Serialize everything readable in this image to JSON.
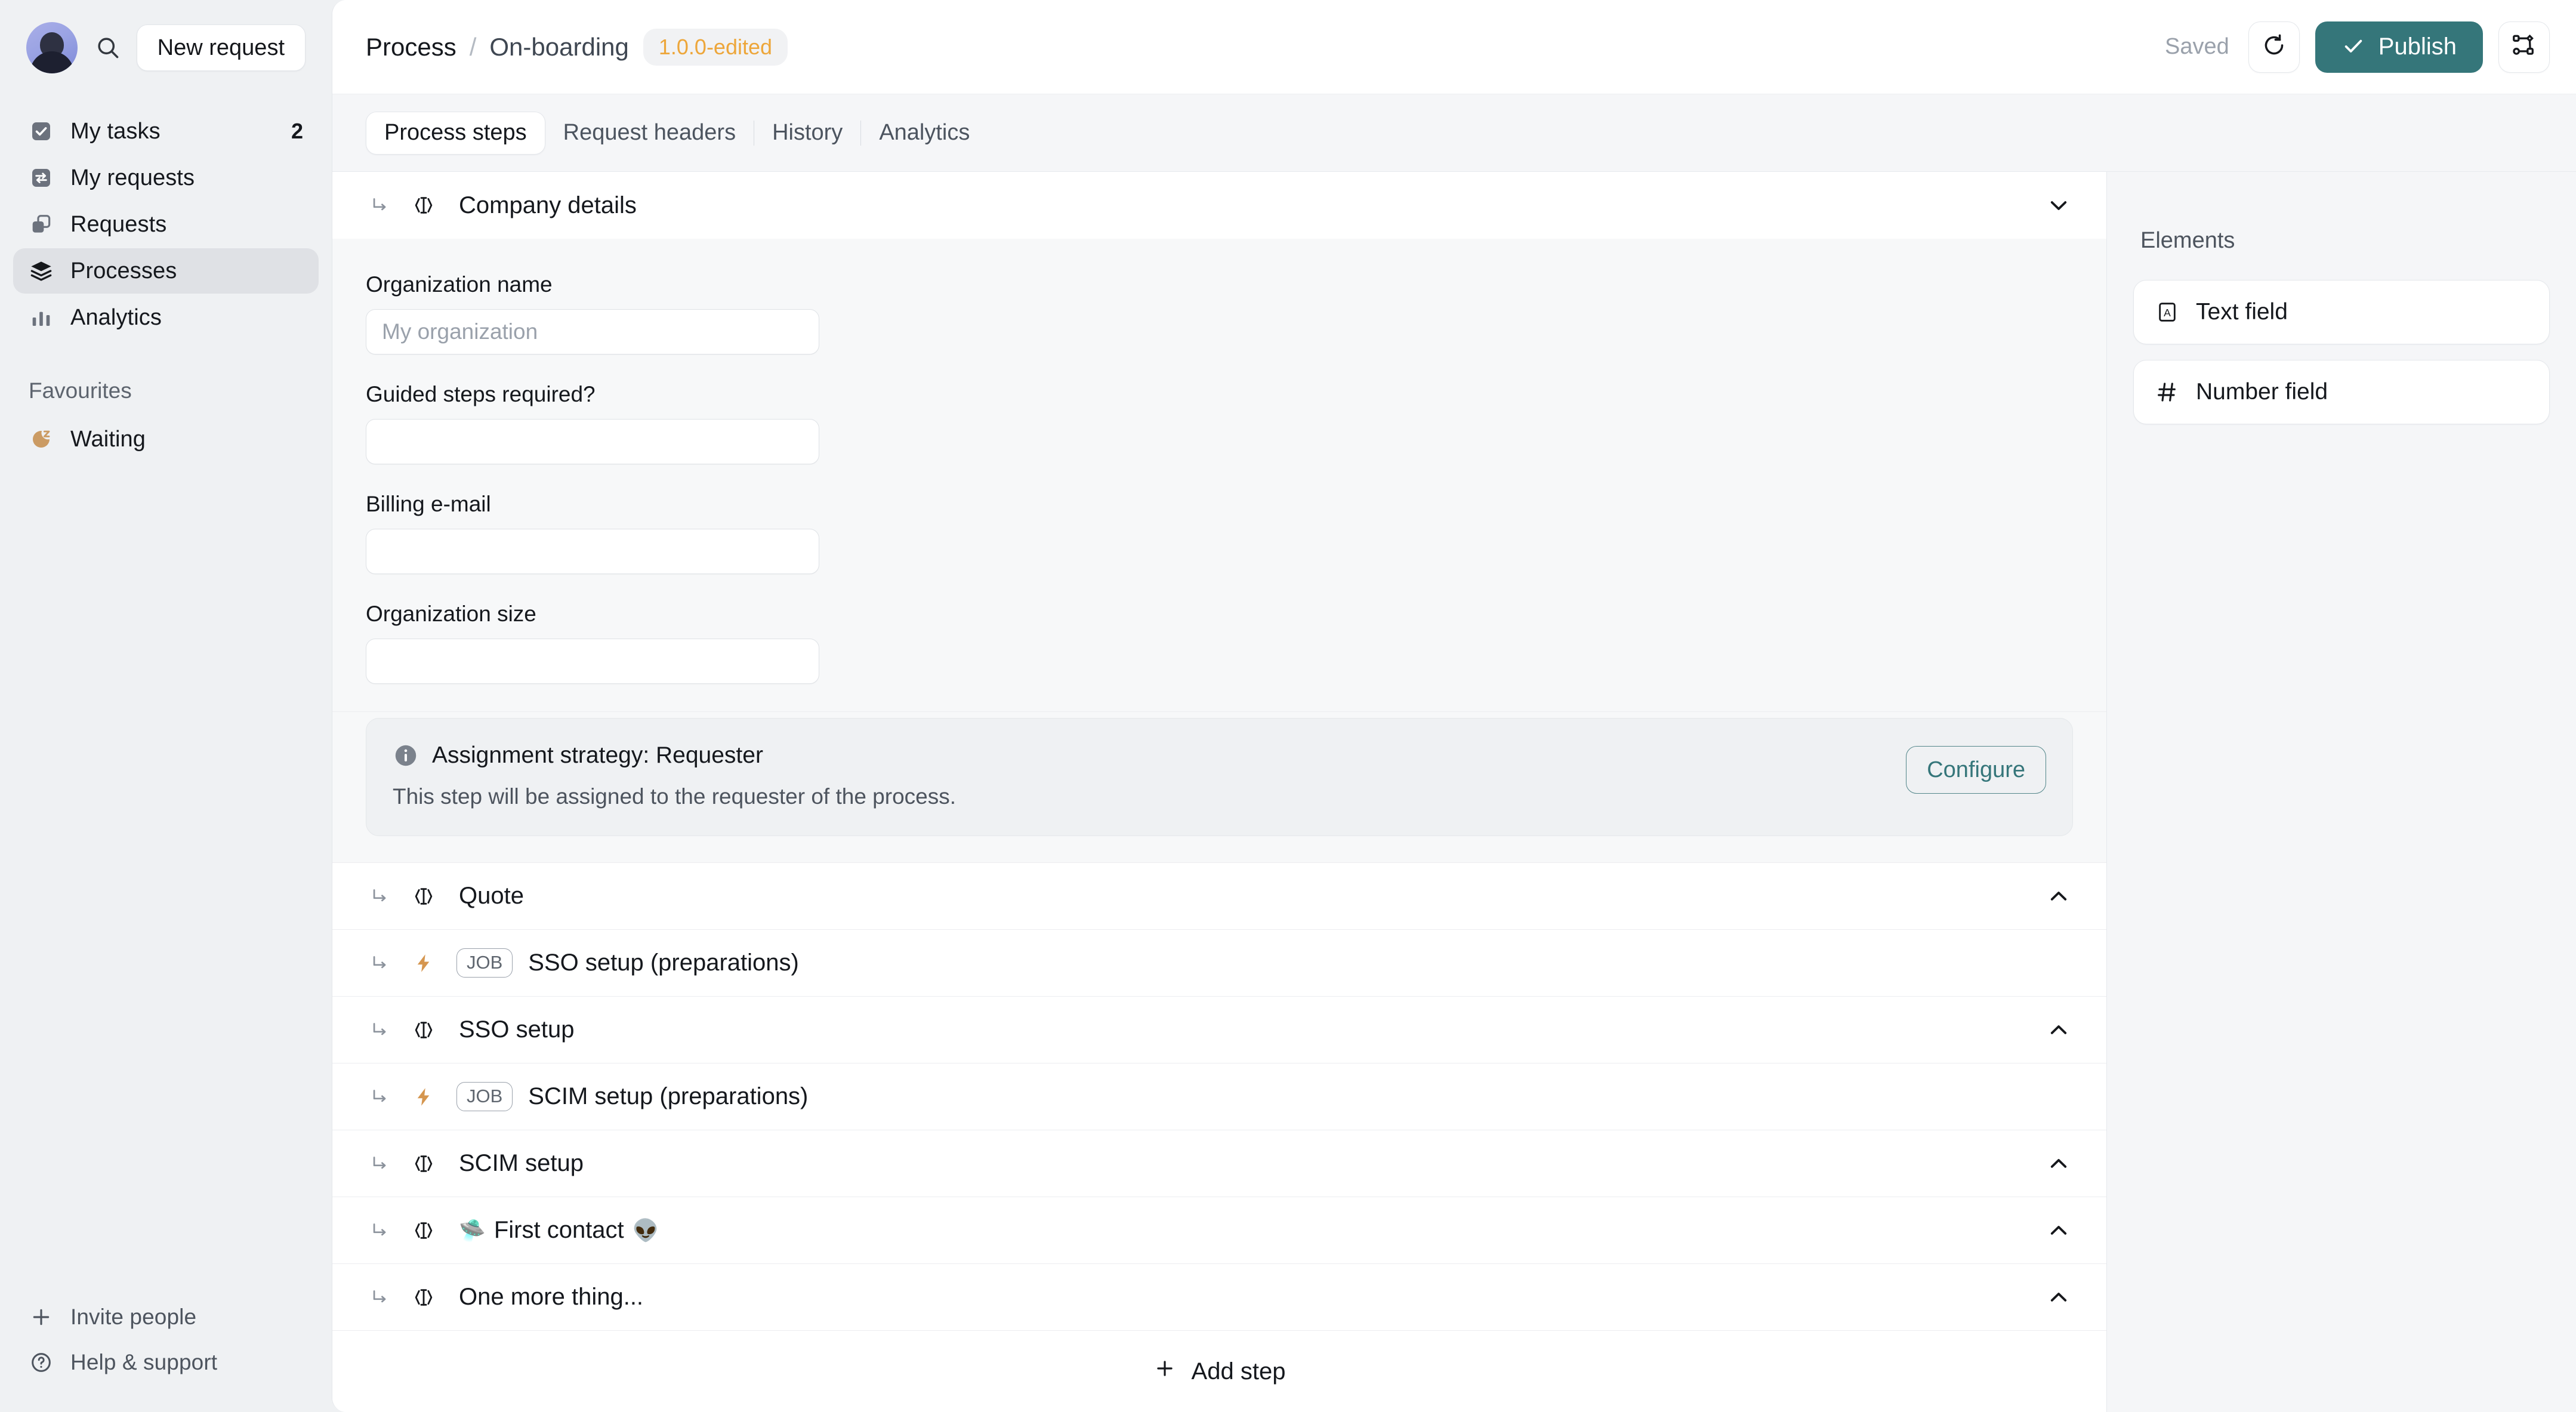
{
  "sidebar": {
    "search_icon": "search-icon",
    "new_request_label": "New request",
    "nav": [
      {
        "label": "My tasks",
        "icon": "checkbox-icon",
        "badge": "2",
        "active": false
      },
      {
        "label": "My requests",
        "icon": "exchange-icon",
        "badge": "",
        "active": false
      },
      {
        "label": "Requests",
        "icon": "copy-icon",
        "badge": "",
        "active": false
      },
      {
        "label": "Processes",
        "icon": "layers-icon",
        "badge": "",
        "active": true
      },
      {
        "label": "Analytics",
        "icon": "bar-chart-icon",
        "badge": "",
        "active": false
      }
    ],
    "favourites_header": "Favourites",
    "favourites": [
      {
        "label": "Waiting",
        "icon": "sleep-icon"
      }
    ],
    "footer": [
      {
        "label": "Invite people",
        "icon": "plus-icon"
      },
      {
        "label": "Help & support",
        "icon": "question-circle-icon"
      }
    ]
  },
  "header": {
    "breadcrumb_root": "Process",
    "breadcrumb_separator": "/",
    "breadcrumb_current": "On-boarding",
    "version_badge": "1.0.0-edited",
    "saved_label": "Saved",
    "refresh_icon": "refresh-icon",
    "publish_label": "Publish",
    "publish_icon": "check-icon",
    "diagram_toggle_icon": "flow-diagram-icon",
    "accent_color": "#35767a",
    "version_color": "#eda63a"
  },
  "tabs": [
    {
      "label": "Process steps",
      "active": true
    },
    {
      "label": "Request headers",
      "active": false
    },
    {
      "label": "History",
      "active": false
    },
    {
      "label": "Analytics",
      "active": false
    }
  ],
  "steps": [
    {
      "title": "Company details",
      "type": "form",
      "expanded": true,
      "chevron": "chevron-down-icon",
      "fields": [
        {
          "label": "Organization name",
          "value": "",
          "placeholder": "My organization"
        },
        {
          "label": "Guided steps required?",
          "value": "",
          "placeholder": ""
        },
        {
          "label": "Billing e-mail",
          "value": "",
          "placeholder": ""
        },
        {
          "label": "Organization size",
          "value": "",
          "placeholder": ""
        }
      ],
      "callout": {
        "icon": "info-icon",
        "title": "Assignment strategy: Requester",
        "description": "This step will be assigned to the requester of the process.",
        "button_label": "Configure"
      }
    },
    {
      "title": "Quote",
      "type": "form",
      "expanded": false,
      "chevron": "chevron-up-icon"
    },
    {
      "title": "SSO setup (preparations)",
      "type": "job",
      "expanded": false,
      "badge": "JOB",
      "chevron": ""
    },
    {
      "title": "SSO setup",
      "type": "form",
      "expanded": false,
      "chevron": "chevron-up-icon"
    },
    {
      "title": "SCIM setup (preparations)",
      "type": "job",
      "expanded": false,
      "badge": "JOB",
      "chevron": ""
    },
    {
      "title": "SCIM setup",
      "type": "form",
      "expanded": false,
      "chevron": "chevron-up-icon"
    },
    {
      "title": "First contact",
      "type": "form",
      "expanded": false,
      "chevron": "chevron-up-icon",
      "emoji_before": "🛸",
      "emoji_after": "👽"
    },
    {
      "title": "One more thing...",
      "type": "form",
      "expanded": false,
      "chevron": "chevron-up-icon"
    }
  ],
  "add_step_label": "Add step",
  "elements_panel": {
    "header": "Elements",
    "items": [
      {
        "label": "Text field",
        "icon": "text-field-icon"
      },
      {
        "label": "Number field",
        "icon": "number-field-icon"
      }
    ]
  }
}
